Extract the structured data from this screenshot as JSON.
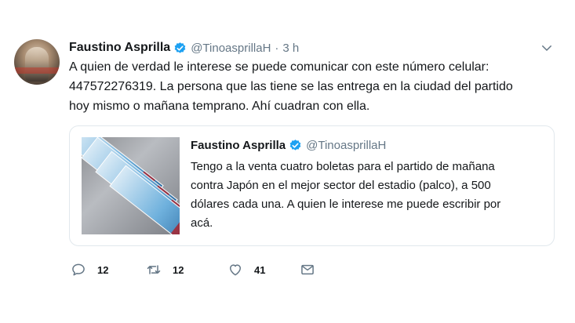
{
  "tweet": {
    "author": {
      "name": "Faustino Asprilla",
      "handle": "@TinoasprillaH",
      "separator": "·",
      "time": "3 h"
    },
    "text_lines": [
      "A quien de verdad le interese se puede comunicar con este número celular:",
      "447572276319. La persona que las tiene se las entrega en la ciudad del partido",
      "hoy mismo o mañana temprano. Ahí cuadran con ella."
    ],
    "quoted": {
      "author": {
        "name": "Faustino Asprilla",
        "handle": "@TinoasprillaH"
      },
      "text_lines": [
        "Tengo a la venta cuatro boletas para el partido de mañana",
        "contra Japón en el mejor sector del estadio (palco), a 500",
        "dólares cada una. A quien le interese me puede escribir por",
        "acá."
      ]
    },
    "actions": {
      "replies": "12",
      "retweets": "12",
      "likes": "41"
    }
  },
  "colors": {
    "verified": "#1da1f2",
    "secondary_text": "#657786",
    "border": "#e1e8ed"
  },
  "icons": [
    "verified-badge-icon",
    "chevron-down-icon",
    "reply-icon",
    "retweet-icon",
    "like-icon",
    "direct-message-icon"
  ]
}
